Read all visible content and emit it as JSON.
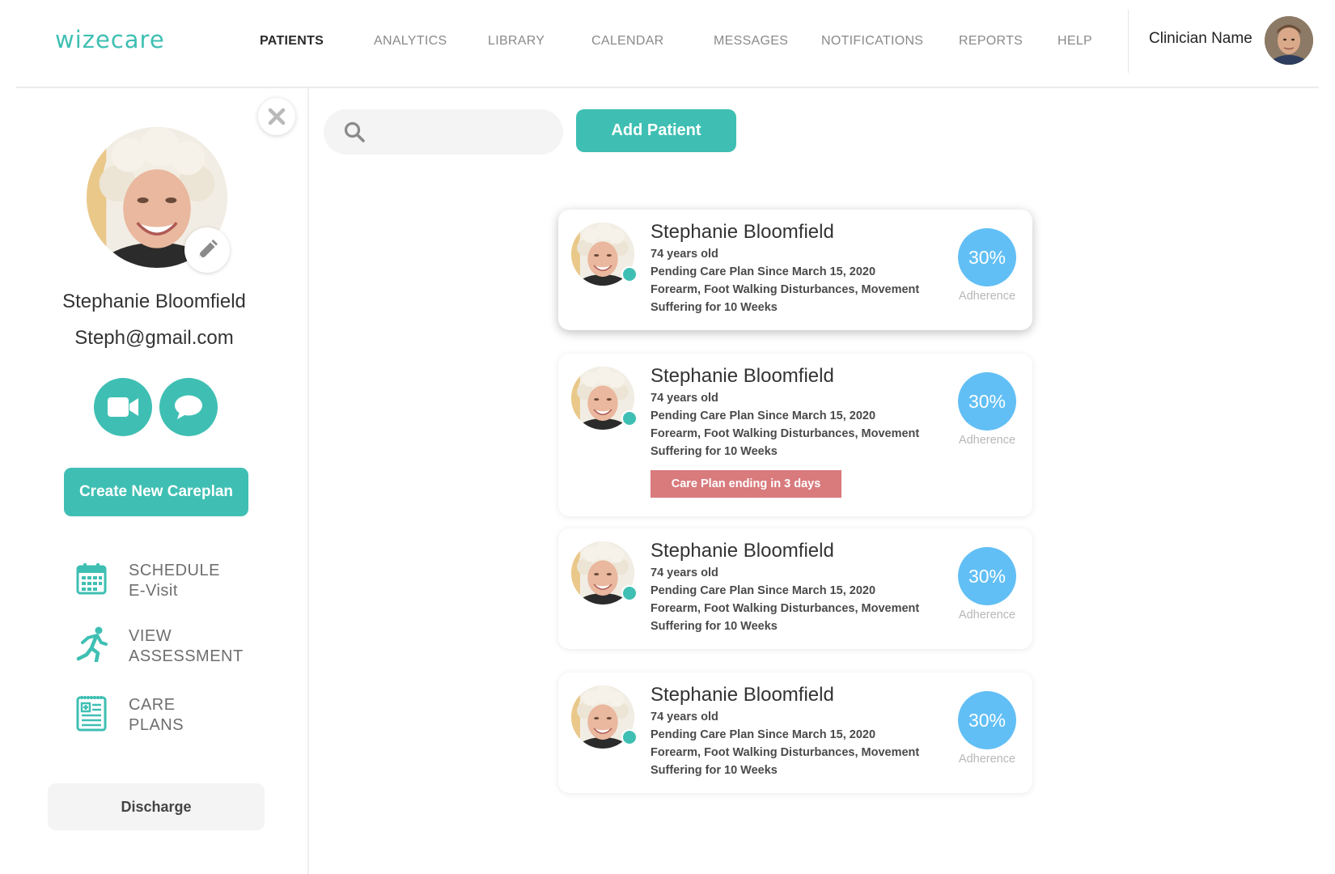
{
  "header": {
    "logo": "wizecare",
    "nav": [
      {
        "label": "PATIENTS",
        "active": true
      },
      {
        "label": "ANALYTICS",
        "active": false
      },
      {
        "label": "LIBRARY",
        "active": false
      },
      {
        "label": "CALENDAR",
        "active": false
      },
      {
        "label": "MESSAGES",
        "active": false
      },
      {
        "label": "NOTIFICATIONS",
        "active": false
      },
      {
        "label": "REPORTS",
        "active": false
      },
      {
        "label": "HELP",
        "active": false
      }
    ],
    "clinician_name": "Clinician Name"
  },
  "sidebar": {
    "patient_name": "Stephanie Bloomfield",
    "patient_email": "Steph@gmail.com",
    "create_careplan_label": "Create New Careplan",
    "links": [
      {
        "line1": "SCHEDULE",
        "line2": "E-Visit",
        "icon": "calendar-icon"
      },
      {
        "line1": "VIEW",
        "line2": "ASSESSMENT",
        "icon": "running-person-icon"
      },
      {
        "line1": "CARE",
        "line2": "PLANS",
        "icon": "clipboard-icon"
      }
    ],
    "discharge_label": "Discharge"
  },
  "main": {
    "search": {
      "placeholder": "",
      "value": ""
    },
    "add_patient_label": "Add Patient",
    "patients": [
      {
        "name": "Stephanie Bloomfield",
        "age": "74 years old",
        "status": "Pending Care Plan Since March 15, 2020",
        "conditions": "Forearm, Foot Walking Disturbances, Movement",
        "duration": "Suffering for 10 Weeks",
        "adherence": "30%",
        "adherence_label": "Adherence",
        "alert": ""
      },
      {
        "name": "Stephanie Bloomfield",
        "age": "74 years old",
        "status": "Pending Care Plan Since March 15, 2020",
        "conditions": "Forearm, Foot Walking Disturbances, Movement",
        "duration": "Suffering for 10 Weeks",
        "adherence": "30%",
        "adherence_label": "Adherence",
        "alert": "Care Plan ending in 3 days"
      },
      {
        "name": "Stephanie Bloomfield",
        "age": "74 years old",
        "status": "Pending Care Plan Since March 15, 2020",
        "conditions": "Forearm, Foot Walking Disturbances, Movement",
        "duration": "Suffering for 10 Weeks",
        "adherence": "30%",
        "adherence_label": "Adherence",
        "alert": ""
      },
      {
        "name": "Stephanie Bloomfield",
        "age": "74 years old",
        "status": "Pending Care Plan Since March 15, 2020",
        "conditions": "Forearm, Foot Walking Disturbances, Movement",
        "duration": "Suffering for 10 Weeks",
        "adherence": "30%",
        "adherence_label": "Adherence",
        "alert": ""
      }
    ]
  },
  "colors": {
    "brand_teal": "#3fbfb3",
    "adherence_blue": "#62bff5",
    "alert_red": "#d97a7d"
  }
}
